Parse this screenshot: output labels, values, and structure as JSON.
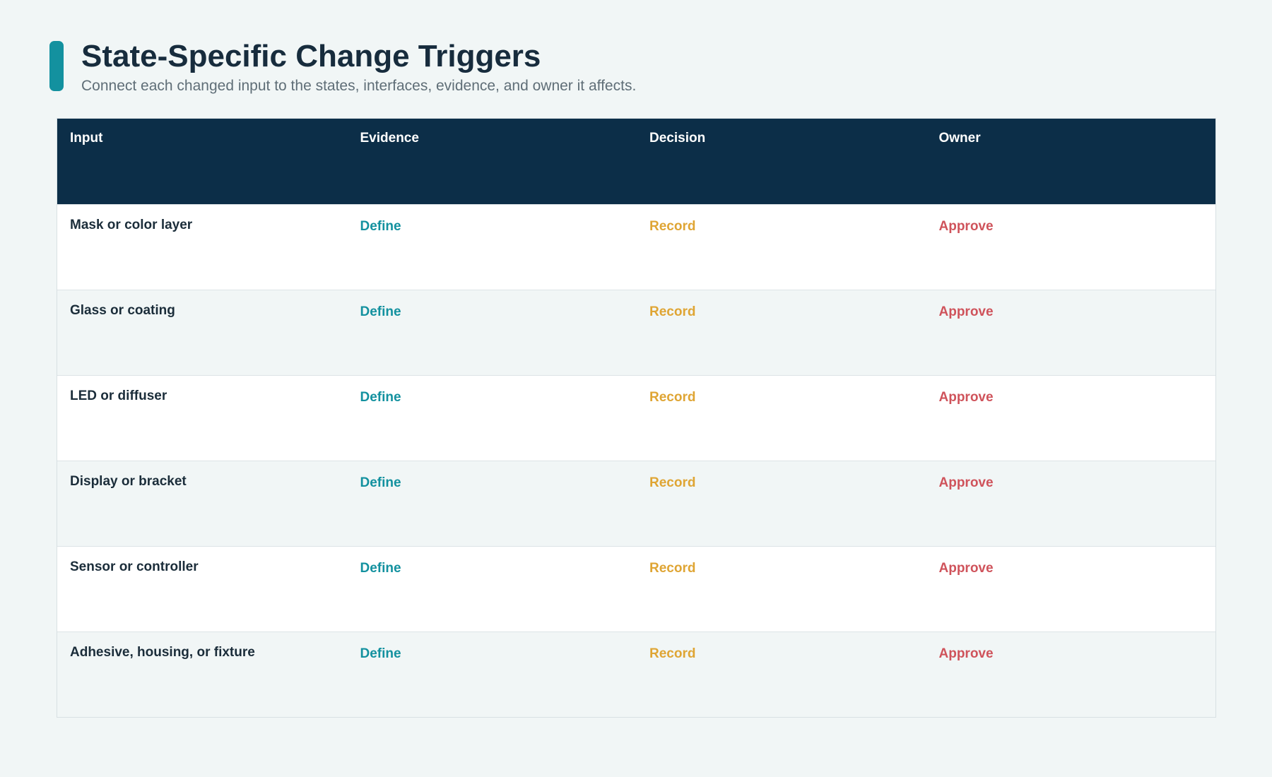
{
  "header": {
    "title": "State-Specific Change Triggers",
    "subtitle": "Connect each changed input to the states, interfaces, evidence, and owner it affects."
  },
  "colors": {
    "accent": "#13919f",
    "header_bg": "#0c2e48",
    "evidence": "#13919f",
    "decision": "#dfa534",
    "owner": "#cf535b"
  },
  "table": {
    "columns": [
      "Input",
      "Evidence",
      "Decision",
      "Owner"
    ],
    "rows": [
      {
        "input": "Mask or color layer",
        "evidence": "Define",
        "decision": "Record",
        "owner": "Approve"
      },
      {
        "input": "Glass or coating",
        "evidence": "Define",
        "decision": "Record",
        "owner": "Approve"
      },
      {
        "input": "LED or diffuser",
        "evidence": "Define",
        "decision": "Record",
        "owner": "Approve"
      },
      {
        "input": "Display or bracket",
        "evidence": "Define",
        "decision": "Record",
        "owner": "Approve"
      },
      {
        "input": "Sensor or controller",
        "evidence": "Define",
        "decision": "Record",
        "owner": "Approve"
      },
      {
        "input": "Adhesive, housing, or fixture",
        "evidence": "Define",
        "decision": "Record",
        "owner": "Approve"
      }
    ]
  }
}
